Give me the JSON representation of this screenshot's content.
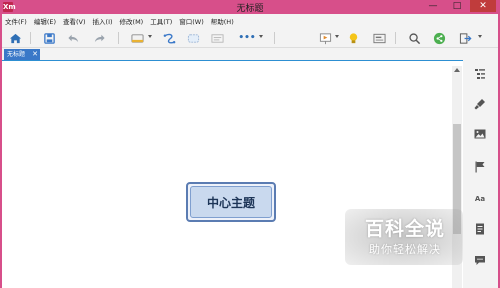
{
  "window": {
    "title": "无标题",
    "app_icon": "Xm",
    "controls": {
      "minimize": "—",
      "maximize": "□",
      "close": "✕"
    }
  },
  "menu": [
    "文件(F)",
    "编辑(E)",
    "查看(V)",
    "插入(I)",
    "修改(M)",
    "工具(T)",
    "窗口(W)",
    "帮助(H)"
  ],
  "toolbar": {
    "icons": [
      "home-icon",
      "save-icon",
      "undo-icon",
      "redo-icon",
      "topic-style-icon",
      "relationship-icon",
      "boundary-icon",
      "more-icon",
      "presentation-icon",
      "idea-bulb-icon",
      "screen-icon",
      "search-icon",
      "share-icon",
      "export-icon"
    ],
    "more_label": "•••"
  },
  "tabs": [
    {
      "label": "无标题",
      "close": "✕"
    }
  ],
  "canvas": {
    "central_topic": "中心主题"
  },
  "side_panel": {
    "icons": [
      "outline-icon",
      "format-brush-icon",
      "image-icon",
      "flag-marker-icon",
      "text-style-icon",
      "notes-icon",
      "comment-icon"
    ],
    "text_style_label": "Aa"
  },
  "watermark": {
    "title": "百科全说",
    "subtitle": "助你轻松解决"
  },
  "colors": {
    "frame": "#d74f8a",
    "accent": "#3a78c8",
    "topic_fill": "#c9d9ee",
    "topic_border": "#5b7cb2"
  }
}
